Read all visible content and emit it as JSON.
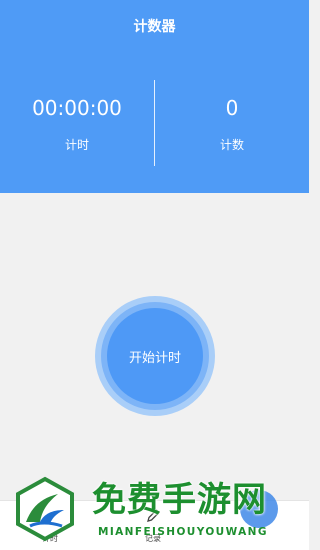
{
  "app": {
    "title": "计数器"
  },
  "stats": {
    "timer": {
      "value": "00:00:00",
      "label": "计时"
    },
    "count": {
      "value": "0",
      "label": "计数"
    }
  },
  "main": {
    "start_button_label": "开始计时"
  },
  "bottom_nav": {
    "items": [
      {
        "label": "计时",
        "icon": "timer-icon"
      },
      {
        "label": "记录",
        "icon": "pencil-icon"
      }
    ]
  },
  "watermark": {
    "text": "免费手游网",
    "subtext": "MIANFEISHOUYOUWANG"
  },
  "colors": {
    "header_bg": "#4f9bf6",
    "page_bg": "#f1f1f1",
    "button_blue": "#4e99f6",
    "watermark_green": "#1d8f2f"
  }
}
